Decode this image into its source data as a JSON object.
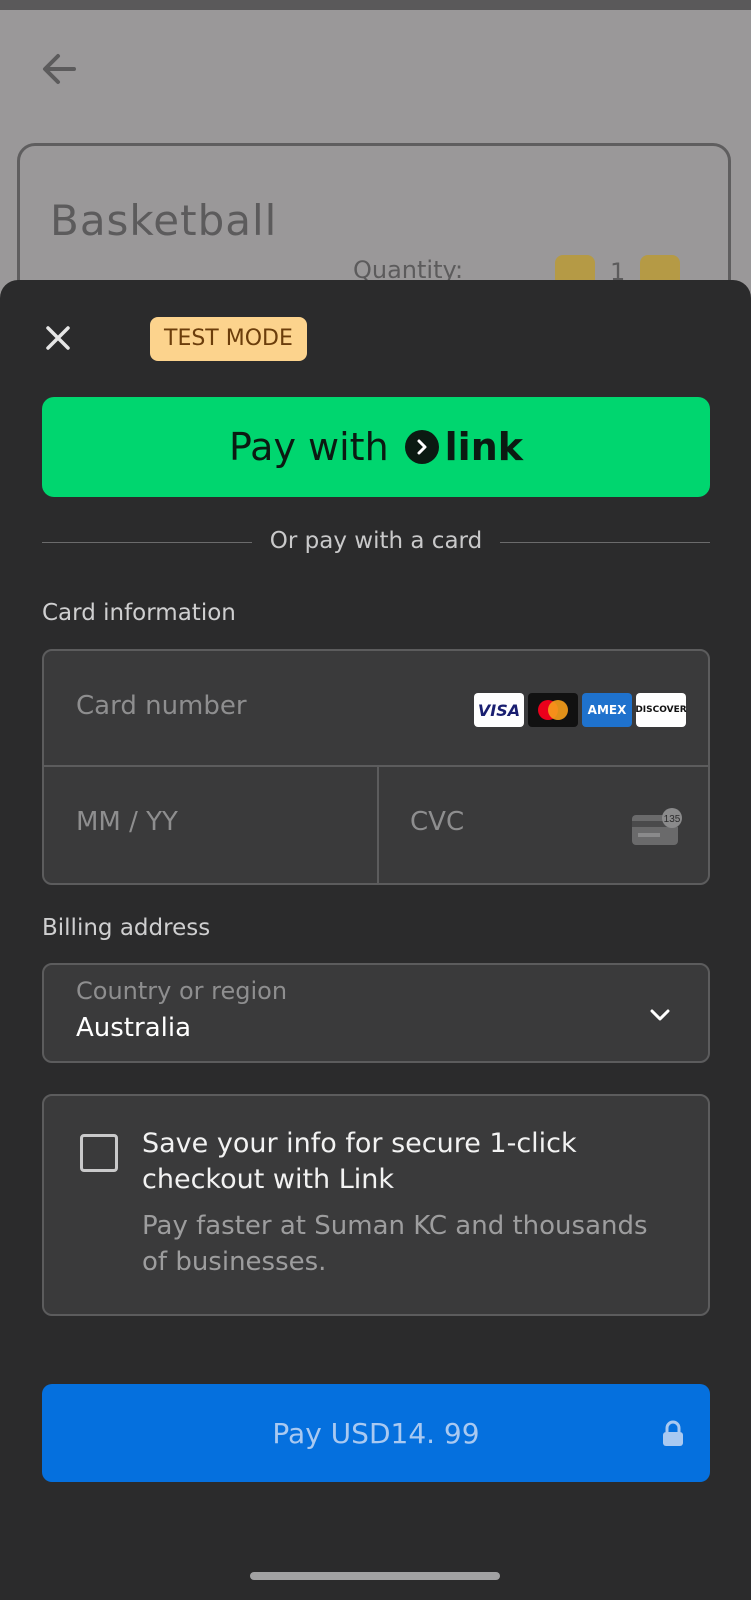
{
  "background_page": {
    "product_title": "Basketball",
    "quantity_label": "Quantity:",
    "quantity_value": "1"
  },
  "sheet": {
    "test_mode_badge": "TEST MODE",
    "link_button": {
      "prefix": "Pay with",
      "logo_text": "link"
    },
    "divider_text": "Or pay with a card",
    "card_info_label": "Card information",
    "card_number_placeholder": "Card number",
    "card_brands": [
      "VISA",
      "mastercard",
      "AMEX",
      "DISCOVER"
    ],
    "expiry_placeholder": "MM / YY",
    "cvc_placeholder": "CVC",
    "cvc_hint_number": "135",
    "billing_label": "Billing address",
    "country_label": "Country or region",
    "country_value": "Australia",
    "save_info_title": "Save your info for secure 1-click checkout with Link",
    "save_info_subtitle": "Pay faster at Suman KC and thousands of businesses.",
    "pay_button_label": "Pay USD14. 99"
  },
  "colors": {
    "link_green": "#00d66f",
    "pay_blue": "#0570de",
    "badge_bg": "#fcd38d",
    "sheet_bg": "#2b2b2c"
  }
}
